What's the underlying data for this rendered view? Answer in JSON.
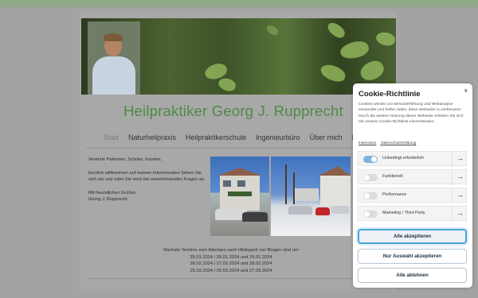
{
  "site": {
    "title": "Heilpraktiker Georg J. Rupprecht",
    "nav": [
      "Start",
      "Naturheilpraxis",
      "Heilpraktikerschule",
      "Ingenieurbüro",
      "Über mich",
      "K"
    ]
  },
  "intro": {
    "greeting": "Verehrte Patienten, Schüler, Kunden,",
    "welcome": "herzlich willkommen auf meinen Internetseiten Sehen Sie sich um und rufen Sie mich bei weiterführenden Fragen an.",
    "closing_1": "Mit freundlichen Grüßen",
    "closing_2": "Georg J. Rupprecht"
  },
  "events": {
    "heading": "Nächste Termine zum Aderlass nach Hildegard von Bingen sind am",
    "dates": [
      "25.01.2024 / 26.01.2024 und 29.01.2024",
      "26.02.2024 / 27.02.2024 und 28.02.2024",
      "25.03.2024 / 26.03.2024 und 27.03.2024"
    ]
  },
  "cookie": {
    "title": "Cookie-Richtlinie",
    "close_label": "x",
    "description": "Cookies werden zur Benutzerführung und Webanalyse verwendet und helfen dabei, diese Webseite zu verbessern. Durch die weitere Nutzung dieser Webseite erklären Sie sich mit unserer Cookie-Richtlinie einverstanden.",
    "link_imprint": "Impressum",
    "link_privacy": "Datenschutzerklärung",
    "preferences": [
      {
        "label": "Unbedingt erforderlich",
        "enabled": true
      },
      {
        "label": "Funktionell",
        "enabled": false
      },
      {
        "label": "Performance",
        "enabled": false
      },
      {
        "label": "Marketing / Third Party",
        "enabled": false
      }
    ],
    "arrow_icon": "→",
    "accept_all": "Alle akzeptieren",
    "accept_selection": "Nur Auswahl akzeptieren",
    "reject_all": "Alle ablehnen"
  },
  "colors": {
    "title_green": "#4d8a44",
    "accent_blue": "#4aa3d8",
    "header_green": "#8faa88"
  }
}
